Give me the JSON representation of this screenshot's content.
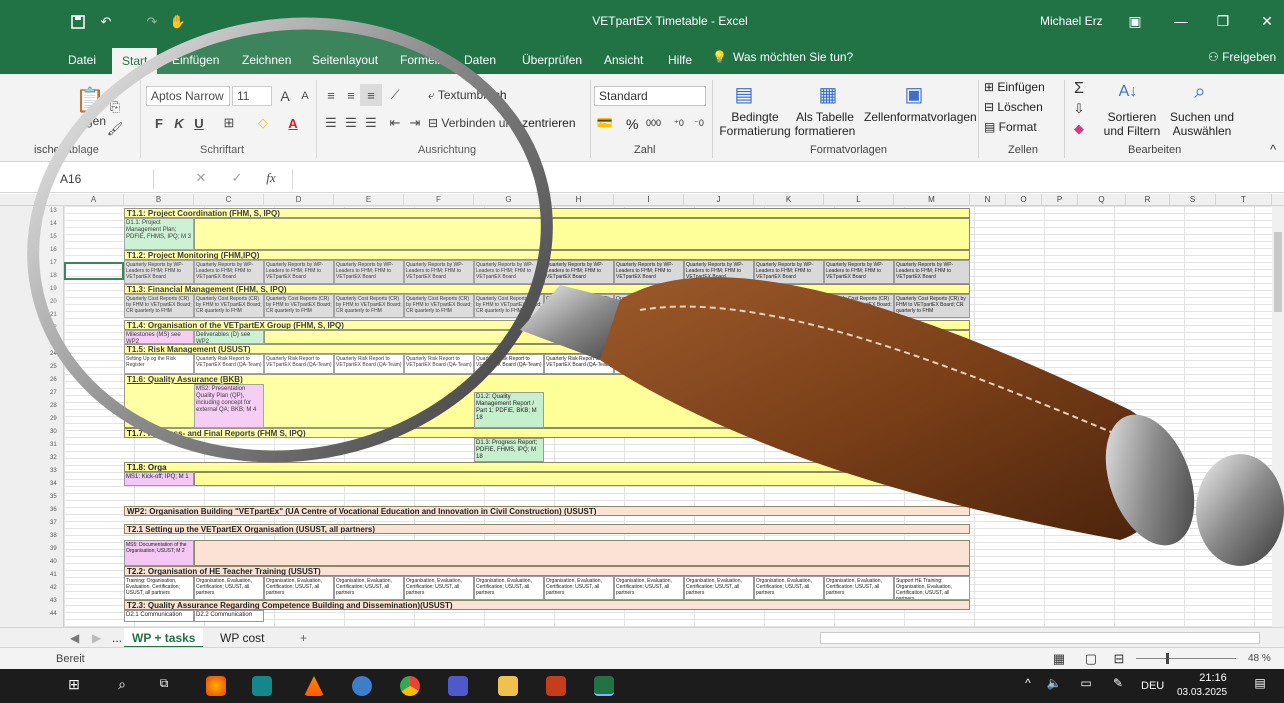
{
  "title_bar": {
    "document_title": "VETpartEX Timetable - Excel",
    "user_name": "Michael Erz",
    "accent": "#217346"
  },
  "menu": {
    "tabs": [
      "Datei",
      "Start",
      "Einfügen",
      "Zeichnen",
      "Seitenlayout",
      "Formeln",
      "Daten",
      "Überprüfen",
      "Ansicht",
      "Hilfe"
    ],
    "tell_me": "Was möchten Sie tun?",
    "share": "Freigeben"
  },
  "ribbon": {
    "font_name": "Aptos Narrow",
    "font_size": "11",
    "wrap_text": "Textumbruch",
    "merge_center": "Verbinden und zentrieren",
    "number_format": "Standard",
    "percent": "%",
    "thousands": "000",
    "conditional_formatting": "Bedingte Formatierung",
    "format_as_table": "Als Tabelle formatieren",
    "cell_styles": "Zellenformatvorlagen",
    "insert": "Einfügen",
    "delete": "Löschen",
    "format": "Format",
    "sort_filter": "Sortieren und Filtern",
    "find_select": "Suchen und Auswählen",
    "paste_fragment": "gen",
    "groups": {
      "clipboard": "ischenablage",
      "font": "Schriftart",
      "alignment": "Ausrichtung",
      "number": "Zahl",
      "styles": "Formatvorlagen",
      "cells": "Zellen",
      "editing": "Bearbeiten"
    }
  },
  "formula_bar": {
    "name_box": "A16",
    "fx": "fx",
    "content": ""
  },
  "columns": [
    "A",
    "B",
    "C",
    "D",
    "E",
    "F",
    "G",
    "H",
    "I",
    "J",
    "K",
    "L",
    "M",
    "N",
    "O",
    "P",
    "Q",
    "R",
    "S",
    "T"
  ],
  "rows": [
    "13",
    "14",
    "15",
    "16",
    "17",
    "18",
    "19",
    "20",
    "21",
    "22",
    "23",
    "24",
    "25",
    "26",
    "27",
    "28",
    "29",
    "30",
    "31",
    "32",
    "33",
    "34",
    "35",
    "36",
    "37",
    "38",
    "39",
    "40",
    "41",
    "42",
    "43",
    "44"
  ],
  "sheet": {
    "t11": "T1.1: Project Coordination (FHM, S, IPQ)",
    "d11": "D1.1: Project Management Plan; PDFIE, FHMS, IPQ; M 3",
    "t12": "T1.2: Project Monitoring (FHM,IPQ)",
    "t12_cell": "Quarterly Reports by WP-Leaders to FHM; FHM to VETpartEX Board",
    "t13": "T1.3: Financial Management (FHM, S, IPQ)",
    "t13_cell": "Quarterly Cost Reports (CR) by FHM to VETpartEX Board; CR quarterly to FHM",
    "t14": "T1.4: Organisation of the VETpartEX Group (FHM, S, IPQ)",
    "t14_ms": "Milestones (MS) see WP2",
    "t14_d": "Deliverables (D) see WP2",
    "t15": "T1.5: Risk Management (USUST)",
    "t15_first": "Setting Up og the Risk Register",
    "t15_cell": "Quarterly Risk Report to VETpartEX Board (QA-Team)",
    "t16": "T1.6: Quality Assurance (BKB)",
    "ms2": "MS2: Presentation Quality Plan (QP), including concept for external QA; BKB; M 4",
    "d12": "D1.2: Quality Management Report / Part 1; PDFIE, BKB; M 18",
    "t17": "T1.7: Progress- and Final Reports (FHM S, IPQ)",
    "d13": "D1.3: Progress Report; PDFIE, FHMS, IPQ; M 18",
    "t18": "T1.8: Orga",
    "ms1": "MS1: Kick-off; IPQ; M 1",
    "wp2": "WP2: Organisation Building \"VETpartEx\" (UA Centre of Vocational Education and Innovation in Civil Construction) (USUST)",
    "t21": "T2.1 Setting up the VETpartEX Organisation (USUST, all partners)",
    "ms5": "MS5: Documentation of the Organisation; USUST; M 2",
    "t22": "T2.2: Organisation of HE Teacher Training (USUST)",
    "t22_first": "Training: Organisation, Evaluation, Certification; USUST, all partners",
    "t22_cell": "Organisation, Evaluation, Certification; USUST, all partners",
    "t22_last": "Support HE Training: Organisation, Evaluation, Certification; USUST, all partners",
    "t23": "T2.3: Quality Assurance Regarding Competence Building and Dissemination)(USUST)",
    "t23_cell": "D2.1 Communication",
    "t23_cell2": "D2.2 Communication"
  },
  "sheet_tabs": {
    "more": "...",
    "active": "WP + tasks",
    "second": "WP cost",
    "add": "+"
  },
  "status_bar": {
    "ready": "Bereit",
    "zoom": "48 %"
  },
  "taskbar": {
    "language": "DEU",
    "time": "21:16",
    "date": "03.03.2025"
  }
}
